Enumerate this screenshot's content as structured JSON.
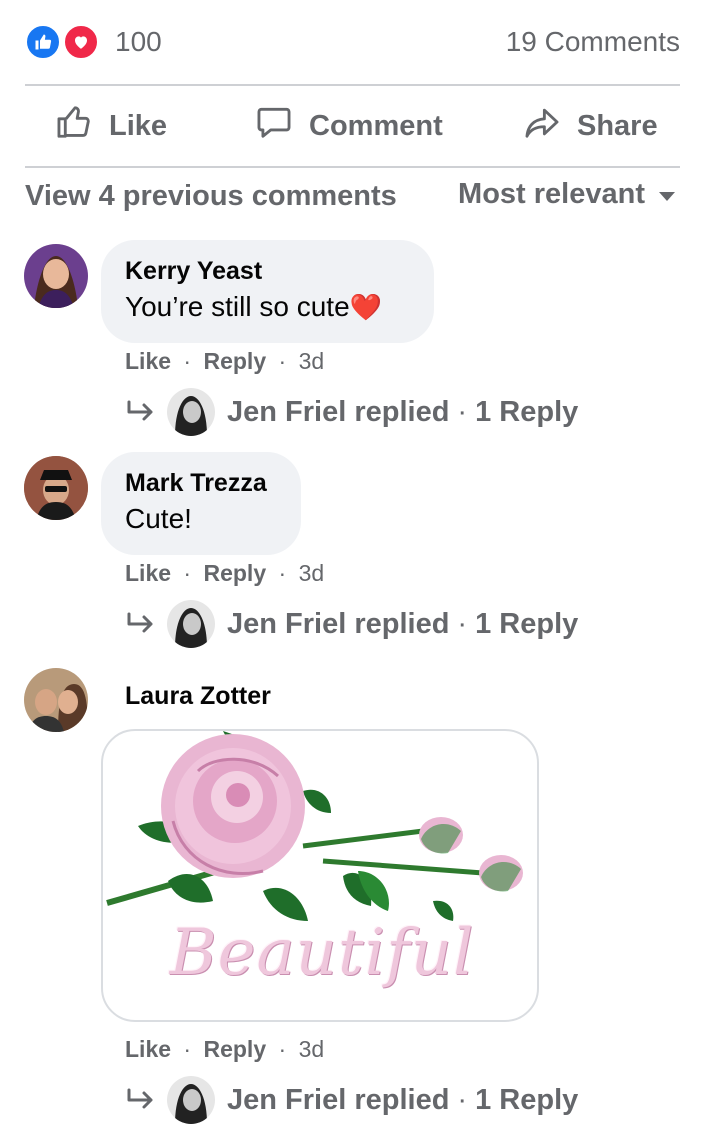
{
  "reactions": {
    "count": "100",
    "comments_count": "19 Comments",
    "like_icon": "thumbs-up-icon",
    "love_icon": "heart-icon",
    "like_color": "#1877f2",
    "love_color": "#f02849"
  },
  "actions": {
    "like_label": "Like",
    "comment_label": "Comment",
    "share_label": "Share"
  },
  "comments_header": {
    "view_previous": "View 4 previous comments",
    "sort_label": "Most relevant"
  },
  "comments": [
    {
      "author": "Kerry Yeast",
      "text": "You’re still so cute",
      "emoji": "❤️",
      "like_label": "Like",
      "sep1": "·",
      "reply_label": "Reply",
      "sep2": "·",
      "time": "3d",
      "reply_summary": "Jen Friel replied",
      "reply_sep": "·",
      "reply_count": "1 Reply"
    },
    {
      "author": "Mark Trezza",
      "text": "Cute!",
      "like_label": "Like",
      "sep1": "·",
      "reply_label": "Reply",
      "sep2": "·",
      "time": "3d",
      "reply_summary": "Jen Friel replied",
      "reply_sep": "·",
      "reply_count": "1 Reply"
    },
    {
      "author": "Laura Zotter",
      "attachment_caption": "Beautiful",
      "like_label": "Like",
      "sep1": "·",
      "reply_label": "Reply",
      "sep2": "·",
      "time": "3d",
      "reply_summary": "Jen Friel replied",
      "reply_sep": "·",
      "reply_count": "1 Reply"
    }
  ],
  "colors": {
    "secondary_text": "#65676b",
    "bubble_bg": "#f0f2f5",
    "divider": "#ced0d4"
  }
}
